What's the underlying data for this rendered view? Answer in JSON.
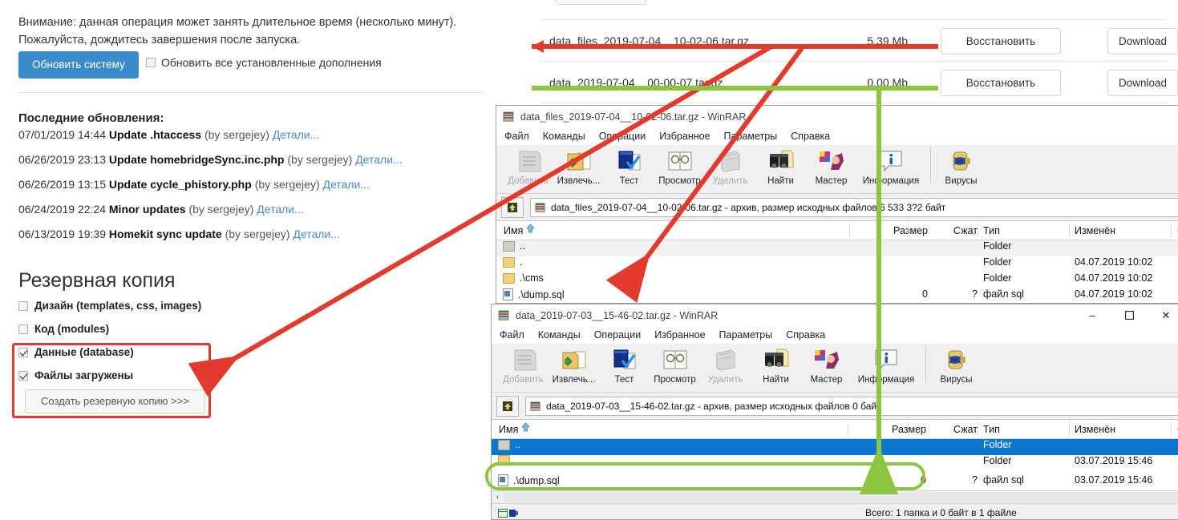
{
  "cms": {
    "notice": "Внимание: данная операция может занять длительное время (несколько минут). Пожалуйста, дождитесь завершения после запуска.",
    "update_button": "Обновить систему",
    "update_addons_label": "Обновить все установленные дополнения",
    "updates_title": "Последние обновления:",
    "updates": [
      {
        "date": "07/01/2019 14:44",
        "title": "Update .htaccess",
        "author": "(by sergejey)",
        "details": "Детали..."
      },
      {
        "date": "06/26/2019 23:13",
        "title": "Update homebridgeSync.inc.php",
        "author": "(by sergejey)",
        "details": "Детали..."
      },
      {
        "date": "06/26/2019 13:15",
        "title": "Update cycle_phistory.php",
        "author": "(by sergejey)",
        "details": "Детали..."
      },
      {
        "date": "06/24/2019 22:24",
        "title": "Minor updates",
        "author": "(by sergejey)",
        "details": "Детали..."
      },
      {
        "date": "06/13/2019 19:39",
        "title": "Homekit sync update",
        "author": "(by sergejey)",
        "details": "Детали..."
      }
    ],
    "backup_title": "Резервная копия",
    "backup_options": [
      {
        "label": "Дизайн (templates, css, images)",
        "checked": false
      },
      {
        "label": "Код (modules)",
        "checked": false
      },
      {
        "label": "Данные (database)",
        "checked": true
      },
      {
        "label": "Файлы загружены",
        "checked": true
      }
    ],
    "create_backup_button": "Создать резервную копию >>>"
  },
  "backup_files": {
    "restore_label": "Восстановить",
    "download_label": "Download",
    "rows": [
      {
        "name": "data_files_2019-07-04__10-02-06.tar.gz",
        "size": "5.39 Mb"
      },
      {
        "name": "data_2019-07-04__00-00-07.tar.gz",
        "size": "0.00 Mb"
      }
    ]
  },
  "winrar_common": {
    "menu": [
      "Файл",
      "Команды",
      "Операции",
      "Избранное",
      "Параметры",
      "Справка"
    ],
    "toolbar": [
      {
        "label": "Добавить",
        "icon": "add-icon",
        "disabled": true
      },
      {
        "label": "Извлечь...",
        "icon": "extract-icon",
        "disabled": false
      },
      {
        "label": "Тест",
        "icon": "test-icon",
        "disabled": false
      },
      {
        "label": "Просмотр",
        "icon": "view-icon",
        "disabled": false
      },
      {
        "label": "Удалить",
        "icon": "delete-icon",
        "disabled": true
      },
      {
        "label": "Найти",
        "icon": "find-icon",
        "disabled": false
      },
      {
        "label": "Мастер",
        "icon": "wizard-icon",
        "disabled": false
      },
      {
        "label": "Информация",
        "icon": "info-icon",
        "disabled": false
      },
      {
        "label": "Вирусы",
        "icon": "virus-icon",
        "disabled": false
      }
    ],
    "columns": [
      "Имя",
      "Размер",
      "Сжат",
      "Тип",
      "Изменён"
    ],
    "minimize": "–",
    "maximize": "❐",
    "close": "✕"
  },
  "winrar1": {
    "title": "data_files_2019-07-04__10-02-06.tar.gz - WinRAR",
    "path": "data_files_2019-07-04__10-02-06.tar.gz -  архив, размер исходных файлов 6 533 3?2 байт",
    "rows": [
      {
        "name": "..",
        "icon": "folder-up-icon",
        "size": "",
        "ratio": "",
        "type": "Folder",
        "modified": ""
      },
      {
        "name": ".",
        "icon": "folder-icon",
        "size": "",
        "ratio": "",
        "type": "Folder",
        "modified": "04.07.2019 10:02"
      },
      {
        "name": ".\\cms",
        "icon": "folder-icon",
        "size": "",
        "ratio": "",
        "type": "Folder",
        "modified": "04.07.2019 10:02"
      },
      {
        "name": ".\\dump.sql",
        "icon": "file-icon",
        "size": "0",
        "ratio": "?",
        "type": "файл sql",
        "modified": "04.07.2019 10:02"
      }
    ]
  },
  "winrar2": {
    "title": "data_2019-07-03__15-46-02.tar.gz - WinRAR",
    "path": "data_2019-07-03__15-46-02.tar.gz -  архив, размер исходных файлов 0 байт",
    "rows": [
      {
        "name": "..",
        "icon": "folder-up-icon",
        "size": "",
        "ratio": "",
        "type": "Folder",
        "modified": "",
        "selected": true
      },
      {
        "name": "",
        "icon": "folder-icon",
        "size": "",
        "ratio": "",
        "type": "Folder",
        "modified": "03.07.2019 15:46",
        "selected": false
      },
      {
        "name": ".\\dump.sql",
        "icon": "file-icon",
        "size": "0",
        "ratio": "?",
        "type": "файл sql",
        "modified": "03.07.2019 15:46",
        "selected": false
      }
    ],
    "status": "Всего: 1 папка и 0 байт в 1 файле"
  },
  "annotations": {
    "red_color": "#e23b2e",
    "green_color": "#8cc63f"
  }
}
